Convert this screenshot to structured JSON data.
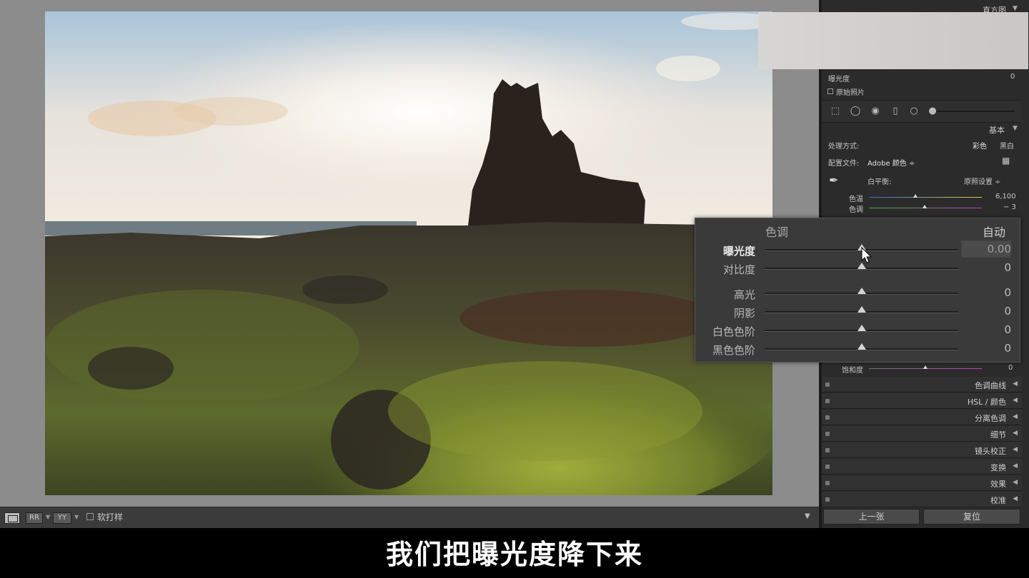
{
  "panel": {
    "histogram_label": "直方图",
    "exposure_readout_label": "曝光度",
    "exposure_readout_value": "0",
    "original_photo_label": "原始照片",
    "basic_label": "基本",
    "treatment_label": "处理方式:",
    "treatment_color": "彩色",
    "treatment_bw": "黑白",
    "profile_label": "配置文件:",
    "profile_value": "Adobe 颜色 ÷",
    "wb_label": "白平衡:",
    "wb_value": "原照设置 ÷",
    "temp_label": "色温",
    "temp_value": "6,100",
    "tint_label": "色调",
    "tint_value": "− 3",
    "saturation_label": "饱和度",
    "saturation_value": "0",
    "sections": [
      {
        "label": "色调曲线"
      },
      {
        "label": "HSL / 颜色"
      },
      {
        "label": "分离色调"
      },
      {
        "label": "细节"
      },
      {
        "label": "镜头校正"
      },
      {
        "label": "变换"
      },
      {
        "label": "效果"
      },
      {
        "label": "校准"
      }
    ],
    "prev_button": "上一张",
    "reset_button": "复位"
  },
  "tone": {
    "title": "色调",
    "auto_label": "自动",
    "sliders": [
      {
        "label": "曝光度",
        "value": "0.00",
        "level": 0.5
      },
      {
        "label": "对比度",
        "value": "0",
        "level": 0.5
      },
      {
        "label": "高光",
        "value": "0",
        "level": 0.5
      },
      {
        "label": "阴影",
        "value": "0",
        "level": 0.5
      },
      {
        "label": "白色色阶",
        "value": "0",
        "level": 0.5
      },
      {
        "label": "黑色色阶",
        "value": "0",
        "level": 0.5
      }
    ]
  },
  "toolbar": {
    "compare_label": "RR",
    "survey_label": "YY",
    "softproof_label": "软打样"
  },
  "subtitle": "我们把曝光度降下来"
}
